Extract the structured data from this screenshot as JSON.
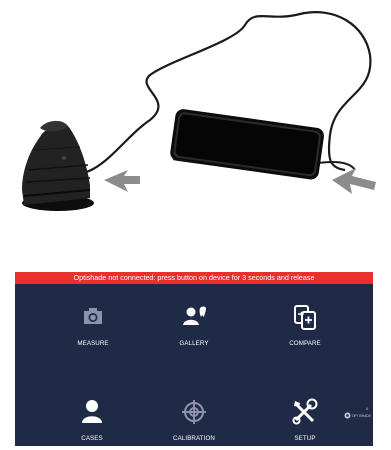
{
  "banner": {
    "message": "Optishade not connected: press button on device for 3 seconds and release"
  },
  "menu": [
    {
      "label": "MEASURE",
      "icon": "camera-icon"
    },
    {
      "label": "GALLERY",
      "icon": "patient-tooth-icon"
    },
    {
      "label": "COMPARE",
      "icon": "compare-icon"
    },
    {
      "label": "CASES",
      "icon": "person-icon"
    },
    {
      "label": "CALIBRATION",
      "icon": "crosshair-icon"
    },
    {
      "label": "SETUP",
      "icon": "tools-icon"
    }
  ],
  "footer": {
    "version": "4.",
    "brand": "OPTISHADE"
  },
  "colors": {
    "app_background": "#1f2a47",
    "warning_bar": "#e8302c",
    "arrow": "#8c8c8c"
  }
}
